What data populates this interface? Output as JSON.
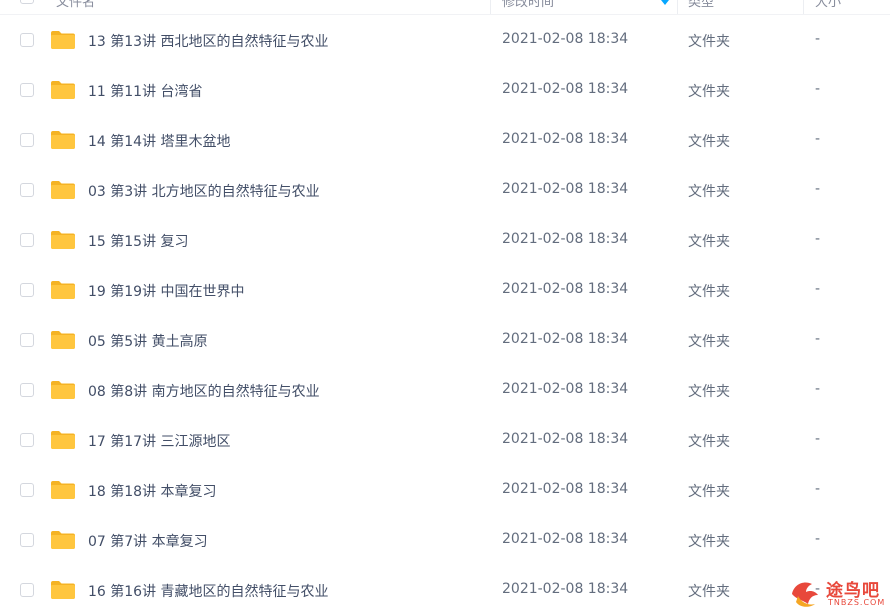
{
  "header": {
    "name": "文件名",
    "time": "修改时间",
    "type": "类型",
    "size": "大小"
  },
  "colors": {
    "folder": "#ffc63f",
    "folder_back": "#f5b324",
    "text": "#424e67",
    "accent": "#06a7ff",
    "watermark": "#e8483b"
  },
  "rows": [
    {
      "name": "13 第13讲 西北地区的自然特征与农业",
      "time": "2021-02-08 18:34",
      "type": "文件夹",
      "size": "-"
    },
    {
      "name": "11 第11讲 台湾省",
      "time": "2021-02-08 18:34",
      "type": "文件夹",
      "size": "-"
    },
    {
      "name": "14 第14讲 塔里木盆地",
      "time": "2021-02-08 18:34",
      "type": "文件夹",
      "size": "-"
    },
    {
      "name": "03 第3讲 北方地区的自然特征与农业",
      "time": "2021-02-08 18:34",
      "type": "文件夹",
      "size": "-"
    },
    {
      "name": "15 第15讲 复习",
      "time": "2021-02-08 18:34",
      "type": "文件夹",
      "size": "-"
    },
    {
      "name": "19 第19讲 中国在世界中",
      "time": "2021-02-08 18:34",
      "type": "文件夹",
      "size": "-"
    },
    {
      "name": "05 第5讲 黄土高原",
      "time": "2021-02-08 18:34",
      "type": "文件夹",
      "size": "-"
    },
    {
      "name": "08 第8讲 南方地区的自然特征与农业",
      "time": "2021-02-08 18:34",
      "type": "文件夹",
      "size": "-"
    },
    {
      "name": "17 第17讲 三江源地区",
      "time": "2021-02-08 18:34",
      "type": "文件夹",
      "size": "-"
    },
    {
      "name": "18 第18讲 本章复习",
      "time": "2021-02-08 18:34",
      "type": "文件夹",
      "size": "-"
    },
    {
      "name": "07 第7讲 本章复习",
      "time": "2021-02-08 18:34",
      "type": "文件夹",
      "size": "-"
    },
    {
      "name": "16 第16讲 青藏地区的自然特征与农业",
      "time": "2021-02-08 18:34",
      "type": "文件夹",
      "size": "-"
    }
  ],
  "watermark": {
    "text": "途鸟吧",
    "url": "TNBZS.COM"
  }
}
